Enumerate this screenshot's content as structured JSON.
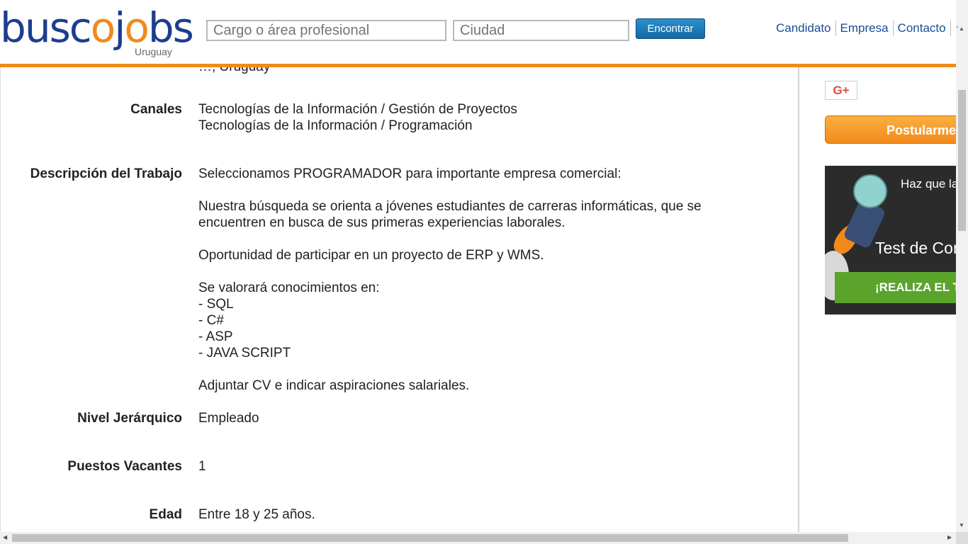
{
  "header": {
    "logo_prefix": "busc",
    "logo_o1": "o",
    "logo_j": "j",
    "logo_o2": "o",
    "logo_suffix": "bs",
    "logo_country": "Uruguay",
    "search_cargo_placeholder": "Cargo o área profesional",
    "search_ciudad_placeholder": "Ciudad",
    "find_button": "Encontrar",
    "nav": [
      "Candidato",
      "Empresa",
      "Contacto"
    ],
    "accent_color": "#f08a1c",
    "brand_color": "#1d3d8f"
  },
  "job": {
    "partial_top_text": "…, Uruguay",
    "canales_label": "Canales",
    "canales": [
      "Tecnologías de la Información / Gestión de Proyectos",
      "Tecnologías de la Información / Programación"
    ],
    "descripcion_label": "Descripción del Trabajo",
    "descripcion": {
      "p1": "Seleccionamos PROGRAMADOR para importante empresa comercial:",
      "p2a": "Nuestra búsqueda se orienta a jóvenes estudiantes de carreras informáticas, que se",
      "p2b": "encuentren en busca de sus primeras experiencias laborales.",
      "p3": "Oportunidad de participar en un proyecto de ERP y WMS.",
      "p4": "Se valorará conocimientos en:",
      "skills": [
        "- SQL",
        "- C#",
        "- ASP",
        "- JAVA SCRIPT"
      ],
      "p5": "Adjuntar CV e indicar aspiraciones salariales."
    },
    "nivel_label": "Nivel Jerárquico",
    "nivel_value": "Empleado",
    "vacantes_label": "Puestos Vacantes",
    "vacantes_value": "1",
    "edad_label": "Edad",
    "edad_value": "Entre 18 y 25 años."
  },
  "sidebar": {
    "gplus_label": "G+",
    "postular_label": "Postularme",
    "ad_line1": "Haz que la",
    "ad_line2": "Test de Con",
    "ad_cta": "¡REALIZA EL T"
  }
}
